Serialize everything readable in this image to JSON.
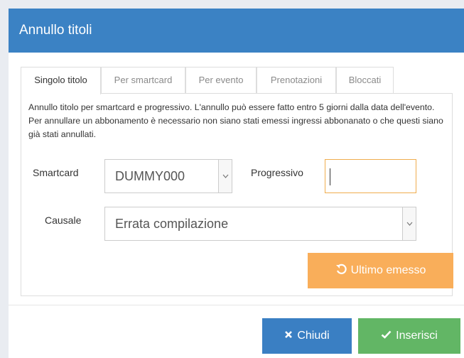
{
  "modal": {
    "title": "Annullo titoli"
  },
  "tabs": [
    {
      "label": "Singolo titolo",
      "active": true
    },
    {
      "label": "Per smartcard",
      "active": false
    },
    {
      "label": "Per evento",
      "active": false
    },
    {
      "label": "Prenotazioni",
      "active": false
    },
    {
      "label": "Bloccati",
      "active": false
    }
  ],
  "panel": {
    "info_text": "Annullo titolo per smartcard e progressivo. L'annullo può essere fatto entro 5 giorni dalla data dell'evento. Per annullare un abbonamento è necessario non siano stati emessi ingressi abbonanato o che questi siano già stati annullati.",
    "smartcard_label": "Smartcard",
    "smartcard_value": "DUMMY000",
    "progressivo_label": "Progressivo",
    "progressivo_value": "",
    "causale_label": "Causale",
    "causale_value": "Errata compilazione",
    "ultimo_emesso_label": "Ultimo emesso"
  },
  "footer": {
    "chiudi_label": "Chiudi",
    "inserisci_label": "Inserisci"
  },
  "icons": {
    "undo": "undo-icon",
    "close": "close-icon",
    "check": "check-icon",
    "dropdown": "chevron-down-icon"
  },
  "colors": {
    "header": "#3b82c4",
    "warning": "#f9ae5a",
    "primary": "#3a7fc3",
    "success": "#62b665"
  }
}
